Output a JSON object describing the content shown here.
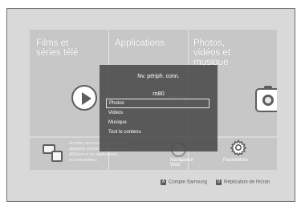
{
  "tiles": [
    {
      "title_line1": "Films et",
      "title_line2": "séries télé"
    },
    {
      "title_line1": "Applications",
      "title_line2": ""
    },
    {
      "title_line1": "Photos,",
      "title_line2": "vidéos et",
      "title_line3": "musique"
    }
  ],
  "bottom_bar": {
    "description": "Accédez aux contenus de vos appareils connectés via le service AllShare et les applications recommandées.",
    "web_browser_label": "Navigateur Web",
    "settings_label": "Paramètres"
  },
  "footer": {
    "a_key": "A",
    "a_label": "Compte Samsung",
    "d_key": "D",
    "d_label": "Réplication de l'écran"
  },
  "popup": {
    "title": "Nv. périph. conn.",
    "device": "m80",
    "items": [
      "Photos",
      "Vidéos",
      "Musique",
      "Tout le contenu"
    ],
    "selected_index": 0
  },
  "icons": {
    "play": "play-icon",
    "camera": "camera-icon",
    "devices": "connected-devices-icon",
    "globe": "globe-icon",
    "gear": "gear-icon"
  }
}
